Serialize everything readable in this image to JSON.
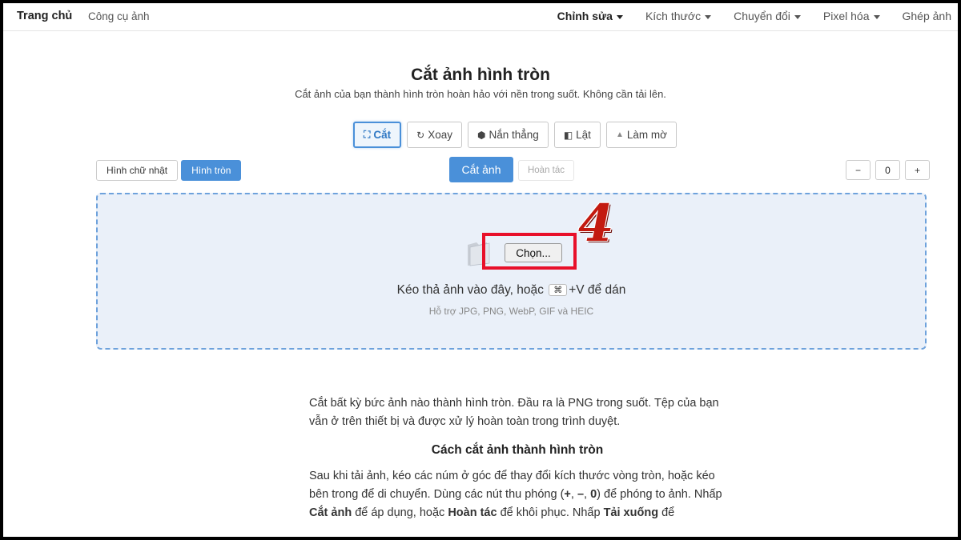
{
  "nav": {
    "brand": "Trang chủ",
    "tool": "Công cụ ảnh",
    "menu": [
      {
        "label": "Chỉnh sửa",
        "active": true,
        "dropdown": true
      },
      {
        "label": "Kích thước",
        "active": false,
        "dropdown": true
      },
      {
        "label": "Chuyển đổi",
        "active": false,
        "dropdown": true
      },
      {
        "label": "Pixel hóa",
        "active": false,
        "dropdown": true
      },
      {
        "label": "Ghép ảnh",
        "active": false,
        "dropdown": false
      }
    ]
  },
  "page": {
    "title": "Cắt ảnh hình tròn",
    "subtitle": "Cắt ảnh của bạn thành hình tròn hoàn hảo với nền trong suốt. Không cần tải lên."
  },
  "tools": [
    {
      "label": "Cắt",
      "icon": "crop-icon",
      "glyph": "⛶",
      "active": true
    },
    {
      "label": "Xoay",
      "icon": "rotate-icon",
      "glyph": "↻",
      "active": false
    },
    {
      "label": "Nắn thẳng",
      "icon": "straighten-icon",
      "glyph": "⬢",
      "active": false
    },
    {
      "label": "Lật",
      "icon": "flip-icon",
      "glyph": "◧",
      "active": false
    },
    {
      "label": "Làm mờ",
      "icon": "blur-icon",
      "glyph": "▲",
      "active": false
    }
  ],
  "shapes": [
    {
      "label": "Hình chữ nhật",
      "selected": false
    },
    {
      "label": "Hình tròn",
      "selected": true
    }
  ],
  "actions": {
    "crop": "Cắt ảnh",
    "undo": "Hoàn tác"
  },
  "zoom": {
    "minus": "−",
    "value": "0",
    "plus": "+"
  },
  "dropzone": {
    "choose": "Chọn...",
    "step_number": "4",
    "text_before": "Kéo thả ảnh vào đây, hoặc",
    "key": "⌘",
    "text_after": "+V để dán",
    "supported": "Hỗ trợ JPG, PNG, WebP, GIF và HEIC"
  },
  "article": {
    "intro": "Cắt bất kỳ bức ảnh nào thành hình tròn. Đầu ra là PNG trong suốt. Tệp của bạn vẫn ở trên thiết bị và được xử lý hoàn toàn trong trình duyệt.",
    "heading": "Cách cắt ảnh thành hình tròn",
    "p1": "Sau khi tải ảnh, kéo các núm ở góc để thay đổi kích thước vòng tròn, hoặc kéo bên trong để di chuyển. Dùng các nút thu phóng (",
    "k1": "+",
    "s1": ", ",
    "k2": "–",
    "s2": ", ",
    "k3": "0",
    "p2": ") để phóng to ảnh. Nhấp ",
    "b1": "Cắt ảnh",
    "p3": " để áp dụng, hoặc ",
    "b2": "Hoàn tác",
    "p4": " để khôi phục. Nhấp ",
    "b3": "Tải xuống",
    "p5": " để"
  },
  "colors": {
    "accent": "#4a90d9",
    "dropzone_bg": "#eaf0f9",
    "highlight_box": "#e8102a",
    "step_number": "#c31a10"
  }
}
